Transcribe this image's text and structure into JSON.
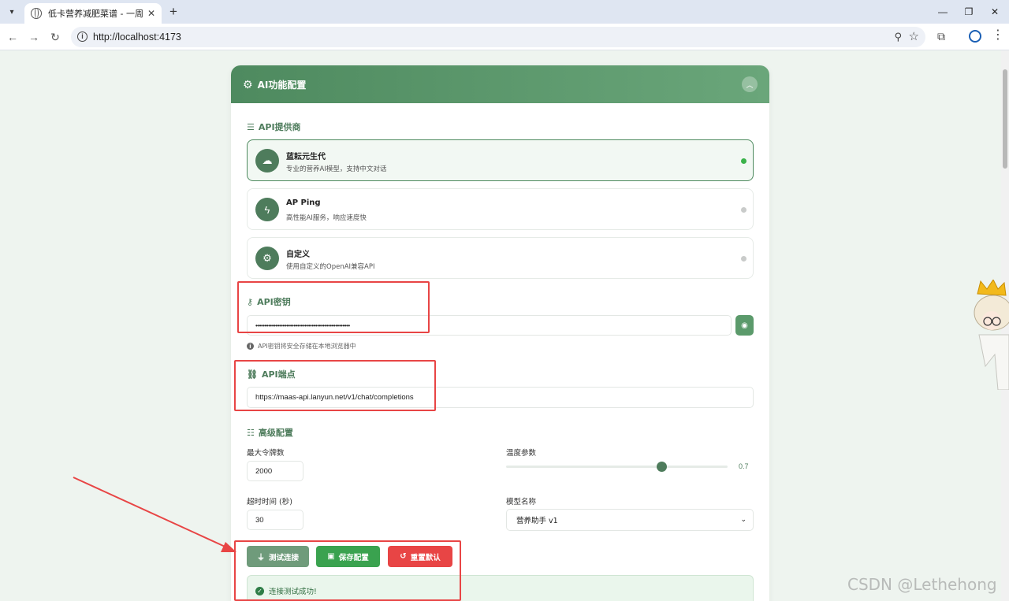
{
  "browser": {
    "tab_title": "低卡营养减肥菜谱 - 一周健康饮",
    "url": "http://localhost:4173"
  },
  "card": {
    "title": "AI功能配置"
  },
  "provider_section": {
    "label": "API提供商",
    "providers": [
      {
        "name": "蓝耘元生代",
        "desc": "专业的营养AI模型，支持中文对话",
        "icon": "cloud-icon",
        "active": true
      },
      {
        "name": "AP Ping",
        "desc": "高性能AI服务，响应速度快",
        "icon": "bolt-icon",
        "active": false
      },
      {
        "name": "自定义",
        "desc": "使用自定义的OpenAI兼容API",
        "icon": "gear-icon",
        "active": false
      }
    ]
  },
  "api_key": {
    "label": "API密钥",
    "value": "••••••••••••••••••••••••••••••••••••••••••••••••••••",
    "hint": "API密钥将安全存储在本地浏览器中"
  },
  "endpoint": {
    "label": "API端点",
    "value": "https://maas-api.lanyun.net/v1/chat/completions"
  },
  "advanced": {
    "label": "高级配置",
    "max_tokens_label": "最大令牌数",
    "max_tokens_value": "2000",
    "temperature_label": "温度参数",
    "temperature_value": "0.7",
    "temperature": 0.7,
    "timeout_label": "超时时间 (秒)",
    "timeout_value": "30",
    "model_label": "模型名称",
    "model_value": "营养助手 v1"
  },
  "actions": {
    "test_label": "测试连接",
    "save_label": "保存配置",
    "reset_label": "重置默认"
  },
  "status": {
    "success_text": "连接测试成功!"
  },
  "colors": {
    "brand_green": "#4e8a5f",
    "save_green": "#3aa24f",
    "reset_red": "#e84545",
    "annotation_red": "#e84545"
  },
  "watermark": "CSDN @Lethehong"
}
